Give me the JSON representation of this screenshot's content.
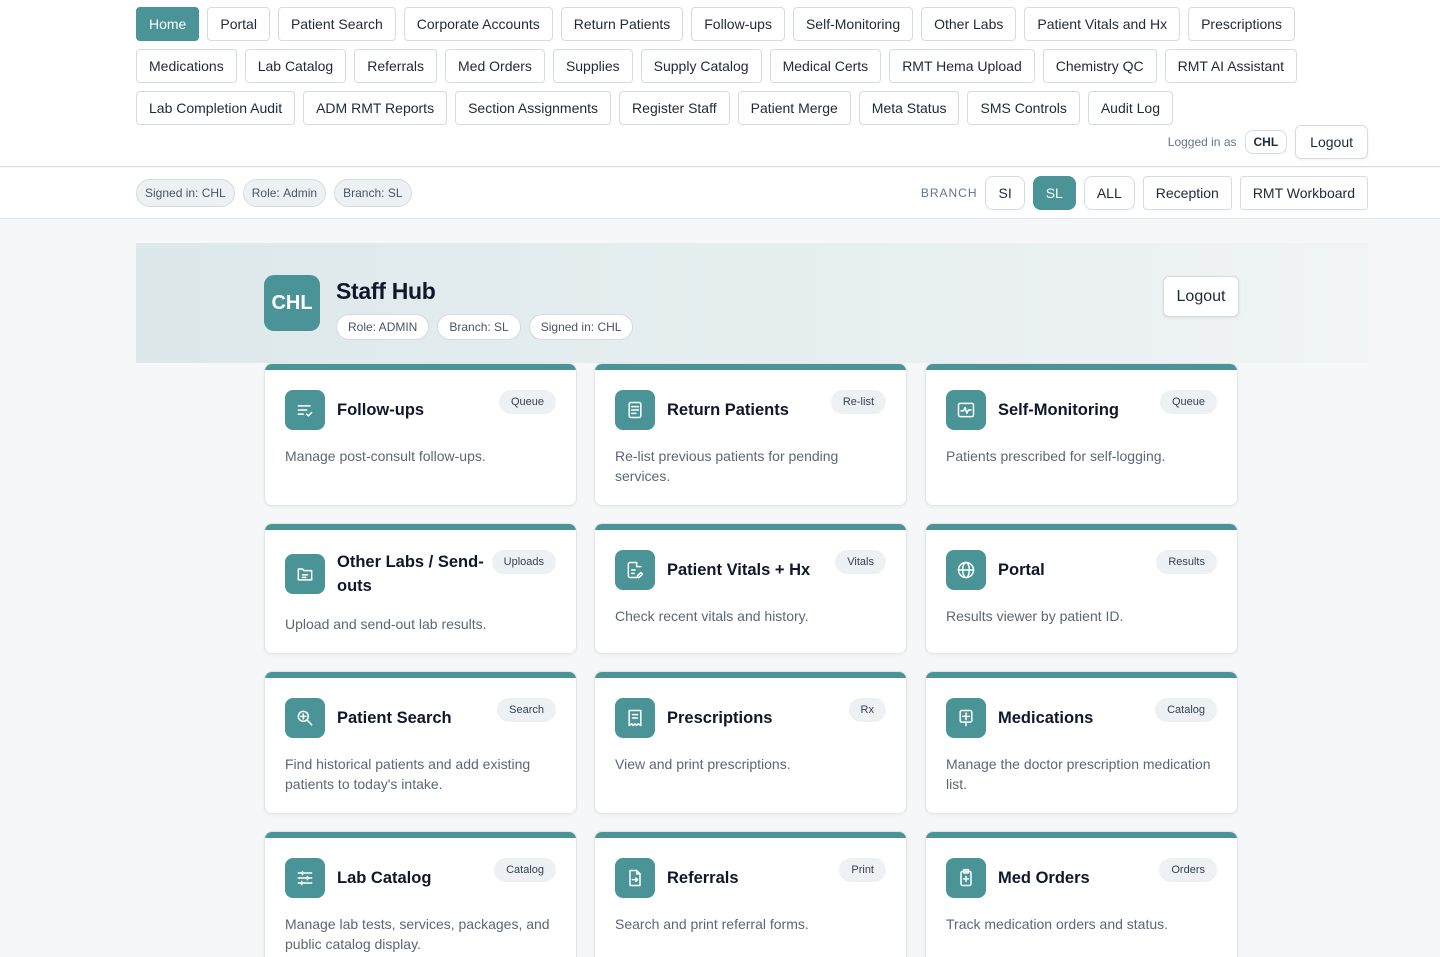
{
  "nav": {
    "items": [
      {
        "label": "Home",
        "active": true
      },
      {
        "label": "Portal"
      },
      {
        "label": "Patient Search"
      },
      {
        "label": "Corporate Accounts"
      },
      {
        "label": "Return Patients"
      },
      {
        "label": "Follow-ups"
      },
      {
        "label": "Self-Monitoring"
      },
      {
        "label": "Other Labs"
      },
      {
        "label": "Patient Vitals and Hx"
      },
      {
        "label": "Prescriptions"
      },
      {
        "label": "Medications"
      },
      {
        "label": "Lab Catalog"
      },
      {
        "label": "Referrals"
      },
      {
        "label": "Med Orders"
      },
      {
        "label": "Supplies"
      },
      {
        "label": "Supply Catalog"
      },
      {
        "label": "Medical Certs"
      },
      {
        "label": "RMT Hema Upload"
      },
      {
        "label": "Chemistry QC"
      },
      {
        "label": "RMT AI Assistant"
      },
      {
        "label": "Lab Completion Audit"
      },
      {
        "label": "ADM RMT Reports"
      },
      {
        "label": "Section Assignments"
      },
      {
        "label": "Register Staff"
      },
      {
        "label": "Patient Merge"
      },
      {
        "label": "Meta Status"
      },
      {
        "label": "SMS Controls"
      },
      {
        "label": "Audit Log"
      }
    ],
    "logged_in_label": "Logged in as",
    "user": "CHL",
    "logout_label": "Logout"
  },
  "status": {
    "chips": [
      {
        "key": "Signed in:",
        "value": "CHL"
      },
      {
        "key": "Role:",
        "value": "Admin"
      },
      {
        "key": "Branch:",
        "value": "SL"
      }
    ],
    "branch_label": "BRANCH",
    "branches": [
      {
        "label": "SI"
      },
      {
        "label": "SL",
        "active": true
      },
      {
        "label": "ALL"
      }
    ],
    "reception_label": "Reception",
    "workboard_label": "RMT Workboard"
  },
  "hero": {
    "avatar": "CHL",
    "title": "Staff Hub",
    "chips": [
      "Role: ADMIN",
      "Branch: SL",
      "Signed in: CHL"
    ],
    "logout_label": "Logout"
  },
  "cards": [
    {
      "title": "Follow-ups",
      "badge": "Queue",
      "desc": "Manage post-consult follow-ups.",
      "icon": "list-check-icon"
    },
    {
      "title": "Return Patients",
      "badge": "Re-list",
      "desc": "Re-list previous patients for pending services.",
      "icon": "document-list-icon"
    },
    {
      "title": "Self-Monitoring",
      "badge": "Queue",
      "desc": "Patients prescribed for self-logging.",
      "icon": "pulse-icon"
    },
    {
      "title": "Other Labs / Send-outs",
      "badge": "Uploads",
      "desc": "Upload and send-out lab results.",
      "icon": "folder-icon"
    },
    {
      "title": "Patient Vitals + Hx",
      "badge": "Vitals",
      "desc": "Check recent vitals and history.",
      "icon": "file-edit-icon"
    },
    {
      "title": "Portal",
      "badge": "Results",
      "desc": "Results viewer by patient ID.",
      "icon": "globe-icon"
    },
    {
      "title": "Patient Search",
      "badge": "Search",
      "desc": "Find historical patients and add existing patients to today's intake.",
      "icon": "zoom-in-icon"
    },
    {
      "title": "Prescriptions",
      "badge": "Rx",
      "desc": "View and print prescriptions.",
      "icon": "receipt-icon"
    },
    {
      "title": "Medications",
      "badge": "Catalog",
      "desc": "Manage the doctor prescription medication list.",
      "icon": "medical-cross-icon"
    },
    {
      "title": "Lab Catalog",
      "badge": "Catalog",
      "desc": "Manage lab tests, services, packages, and public catalog display.",
      "icon": "sliders-icon"
    },
    {
      "title": "Referrals",
      "badge": "Print",
      "desc": "Search and print referral forms.",
      "icon": "file-arrow-icon"
    },
    {
      "title": "Med Orders",
      "badge": "Orders",
      "desc": "Track medication orders and status.",
      "icon": "clipboard-icon"
    }
  ],
  "colors": {
    "accent": "#4a9497",
    "background": "#f5f7f8"
  }
}
